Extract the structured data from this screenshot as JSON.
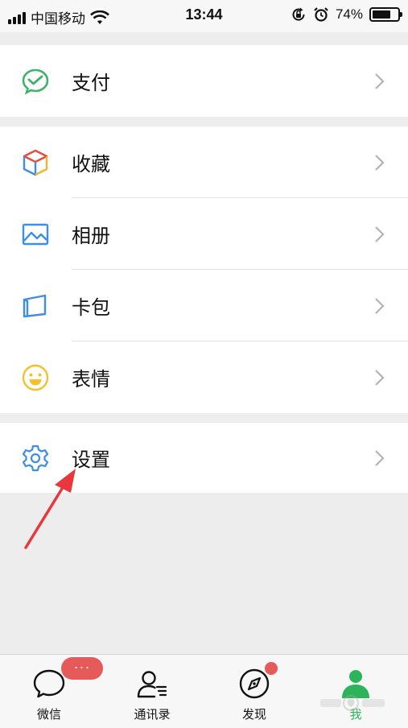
{
  "status_bar": {
    "carrier": "中国移动",
    "time": "13:44",
    "battery": "74%",
    "battery_level": 0.74
  },
  "groups": [
    {
      "items": [
        {
          "label": "支付",
          "icon": "wechat-pay-icon"
        }
      ]
    },
    {
      "items": [
        {
          "label": "收藏",
          "icon": "favorites-cube-icon"
        },
        {
          "label": "相册",
          "icon": "album-image-icon"
        },
        {
          "label": "卡包",
          "icon": "card-wallet-icon"
        },
        {
          "label": "表情",
          "icon": "sticker-smiley-icon"
        }
      ]
    },
    {
      "items": [
        {
          "label": "设置",
          "icon": "settings-gear-icon"
        }
      ]
    }
  ],
  "tabbar": {
    "tabs": [
      {
        "label": "微信",
        "icon": "chat-bubble-icon"
      },
      {
        "label": "通讯录",
        "icon": "contacts-icon"
      },
      {
        "label": "发现",
        "icon": "compass-icon"
      },
      {
        "label": "我",
        "icon": "me-person-icon"
      }
    ],
    "badge_text": "···"
  },
  "colors": {
    "accent_green": "#2db45a",
    "badge_red": "#e65a5a",
    "annotation_arrow": "#e8383d"
  }
}
